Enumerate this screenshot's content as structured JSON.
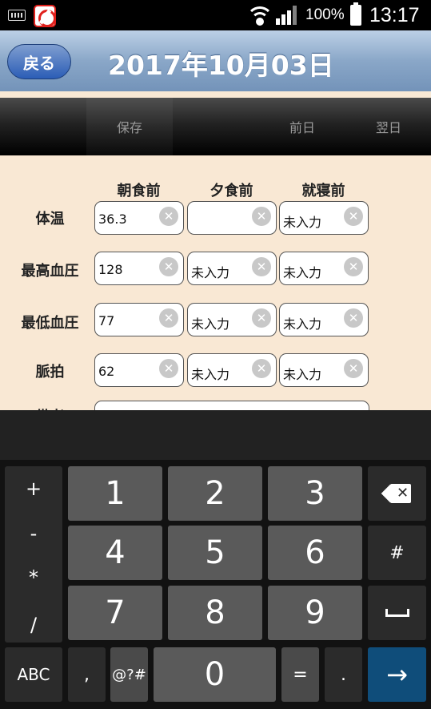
{
  "status_bar": {
    "battery": "100%",
    "time": "13:17"
  },
  "header": {
    "back_label": "戻る",
    "title": "2017年10月03日"
  },
  "toolbar": {
    "save_label": "保存",
    "prev_label": "前日",
    "next_label": "翌日"
  },
  "form": {
    "columns": [
      "朝食前",
      "夕食前",
      "就寝前"
    ],
    "rows": [
      {
        "label": "体温",
        "values": [
          "36.3",
          "",
          "未入力"
        ]
      },
      {
        "label": "最高血圧",
        "values": [
          "128",
          "未入力",
          "未入力"
        ]
      },
      {
        "label": "最低血圧",
        "values": [
          "77",
          "未入力",
          "未入力"
        ]
      },
      {
        "label": "脈拍",
        "values": [
          "62",
          "未入力",
          "未入力"
        ]
      }
    ],
    "next_row_label": "備考"
  },
  "keyboard": {
    "symbols": [
      "+",
      "-",
      "*",
      "/"
    ],
    "digits": [
      "1",
      "2",
      "3",
      "4",
      "5",
      "6",
      "7",
      "8",
      "9",
      "0"
    ],
    "hash": "#",
    "abc": "ABC",
    "comma": ",",
    "symbols_key": "@?#",
    "equals": "=",
    "period": ".",
    "enter": "→",
    "backspace_icon": "backspace-icon",
    "space_icon": "space-icon"
  },
  "colors": {
    "header_bg": "#8aa7c8",
    "back_button": "#2b5db6",
    "content_bg": "#f9e8d4",
    "enter_key": "#0f4d7a"
  }
}
